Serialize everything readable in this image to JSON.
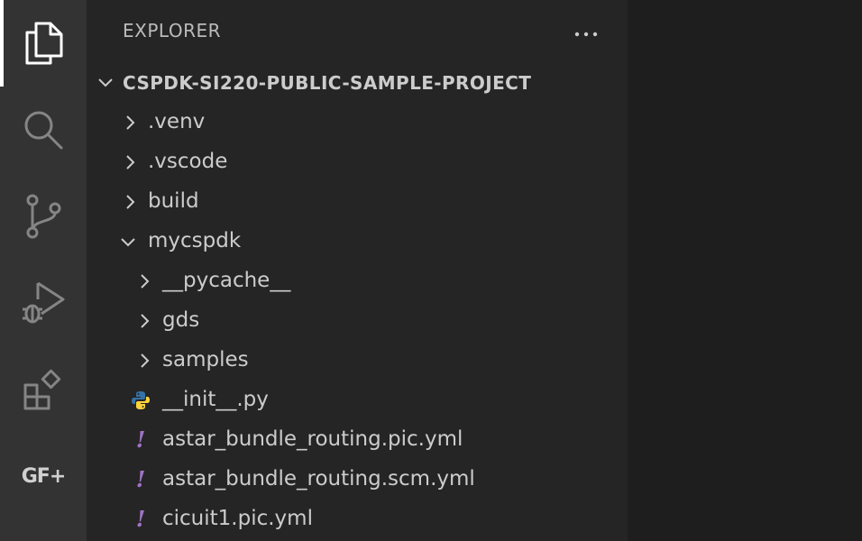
{
  "activity_bar": {
    "items": [
      {
        "id": "explorer",
        "icon": "files-icon",
        "active": true
      },
      {
        "id": "search",
        "icon": "search-icon"
      },
      {
        "id": "source-control",
        "icon": "source-control-icon"
      },
      {
        "id": "run-debug",
        "icon": "run-debug-icon"
      },
      {
        "id": "extensions",
        "icon": "extensions-icon"
      },
      {
        "id": "gdsfactory",
        "icon": "gf-plus-icon",
        "label": "GF+"
      }
    ]
  },
  "sidebar": {
    "title": "EXPLORER",
    "more_actions_icon": "ellipsis-icon",
    "section": {
      "title": "CSPDK-SI220-PUBLIC-SAMPLE-PROJECT",
      "expanded": true
    },
    "tree": [
      {
        "name": ".venv",
        "type": "folder",
        "expanded": false
      },
      {
        "name": ".vscode",
        "type": "folder",
        "expanded": false
      },
      {
        "name": "build",
        "type": "folder",
        "expanded": false
      },
      {
        "name": "mycspdk",
        "type": "folder",
        "expanded": true
      },
      {
        "name": "__pycache__",
        "type": "folder",
        "expanded": false
      },
      {
        "name": "gds",
        "type": "folder",
        "expanded": false
      },
      {
        "name": "samples",
        "type": "folder",
        "expanded": false
      },
      {
        "name": "__init__.py",
        "type": "file",
        "icon": "python-icon"
      },
      {
        "name": "astar_bundle_routing.pic.yml",
        "type": "file",
        "icon": "yaml-icon"
      },
      {
        "name": "astar_bundle_routing.scm.yml",
        "type": "file",
        "icon": "yaml-icon"
      },
      {
        "name": "cicuit1.pic.yml",
        "type": "file",
        "icon": "yaml-icon"
      }
    ]
  },
  "colors": {
    "activity_bar_bg": "#333333",
    "sidebar_bg": "#252526",
    "editor_bg": "#1e1e1e",
    "text": "#cccccc",
    "yaml_icon": "#a074c4",
    "python_icon_blue": "#3572a5",
    "python_icon_yellow": "#ffd43b"
  }
}
